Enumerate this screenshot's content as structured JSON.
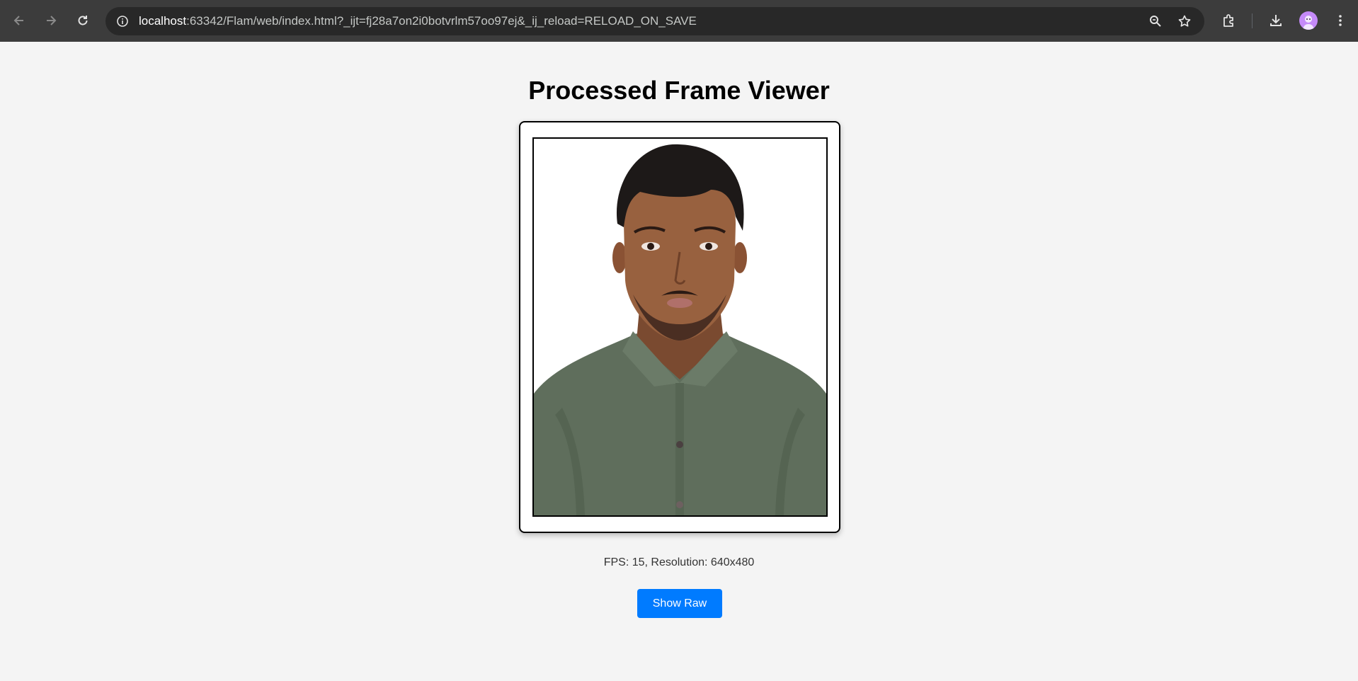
{
  "browser": {
    "url_host": "localhost",
    "url_rest": ":63342/Flam/web/index.html?_ijt=fj28a7on2i0botvrlm57oo97ej&_ij_reload=RELOAD_ON_SAVE",
    "icons": [
      "back-icon",
      "forward-icon",
      "reload-icon",
      "site-info-icon",
      "zoom-icon",
      "bookmark-star-icon",
      "extensions-icon",
      "download-icon",
      "profile-avatar",
      "menu-icon"
    ],
    "toolbar_color": "#3c3c3c"
  },
  "page": {
    "title": "Processed Frame Viewer",
    "stats": "FPS: 15, Resolution: 640x480",
    "show_raw_label": "Show Raw",
    "button_color": "#007bff",
    "background": "#f4f4f4"
  }
}
